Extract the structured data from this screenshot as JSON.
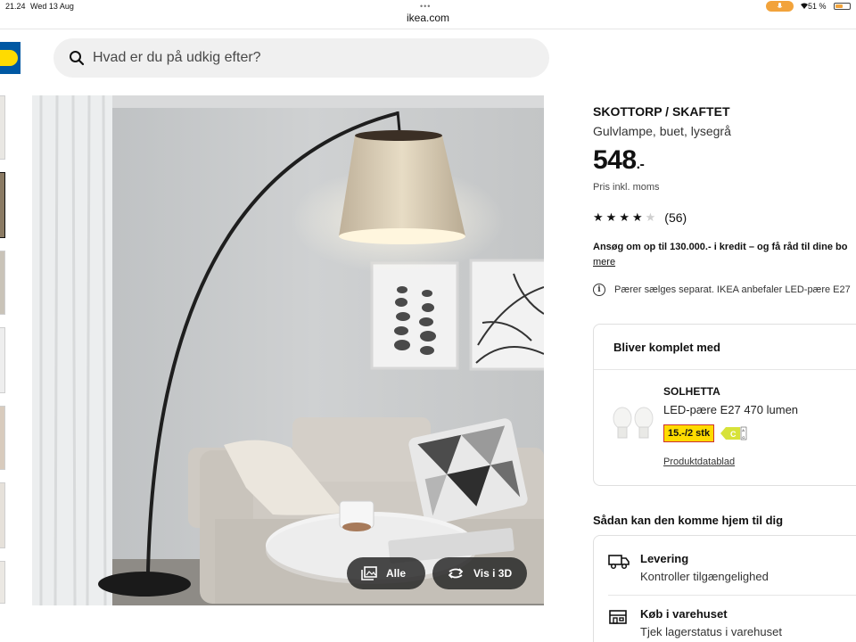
{
  "statusbar": {
    "time": "21.24",
    "date": "Wed 13 Aug",
    "battery": "51 %",
    "battery_level": 0.51
  },
  "browser": {
    "url": "ikea.com"
  },
  "search": {
    "placeholder": "Hvad er du på udkig efter?"
  },
  "product": {
    "name": "SKOTTORP / SKAFTET",
    "description": "Gulvlampe, buet, lysegrå",
    "price": "548",
    "price_suffix": ".-",
    "price_note": "Pris inkl. moms",
    "rating": 4,
    "rating_max": 5,
    "review_count": "(56)",
    "credit_text": "Ansøg om op til 130.000.- i kredit – og få råd til dine bo",
    "credit_more": "mere",
    "bulb_note": "Pærer sælges separat. IKEA anbefaler LED-pære E27"
  },
  "image_buttons": {
    "all": "Alle",
    "view3d": "Vis i 3D"
  },
  "complement": {
    "header": "Bliver komplet med",
    "item_name": "SOLHETTA",
    "item_desc": "LED-pære E27 470 lumen",
    "item_price": "15.-/2 stk",
    "energy_class": "C",
    "datasheet_link": "Produktdatablad"
  },
  "delivery": {
    "title": "Sådan kan den komme hjem til dig",
    "options": [
      {
        "title": "Levering",
        "subtitle": "Kontroller tilgængelighed",
        "icon": "truck-icon"
      },
      {
        "title": "Køb i varehuset",
        "subtitle": "Tjek lagerstatus i varehuset",
        "icon": "store-icon"
      }
    ]
  },
  "colors": {
    "ikea_blue": "#0058a3",
    "ikea_yellow": "#ffdb00",
    "price_box_border": "#cc3333"
  }
}
